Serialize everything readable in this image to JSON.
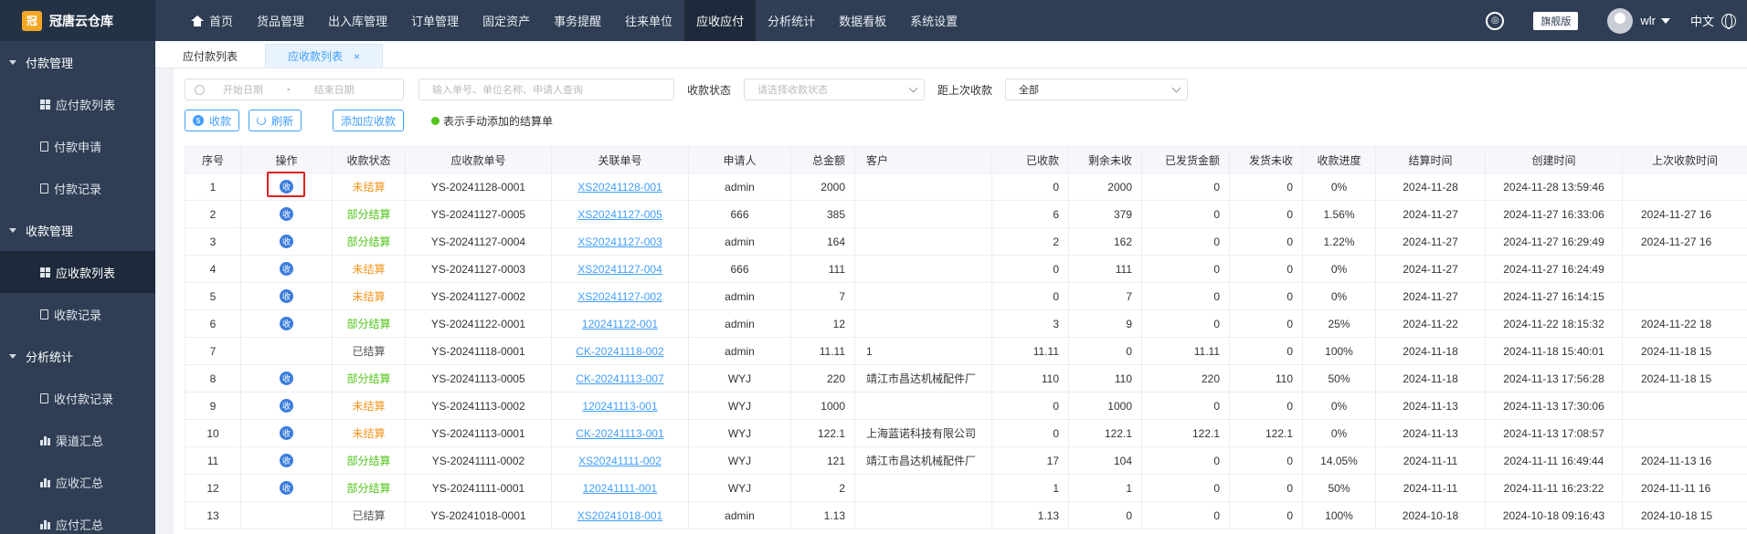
{
  "brand": {
    "logo_text": "冠",
    "name": "冠唐云仓库"
  },
  "nav": [
    {
      "label": "首页",
      "active": false
    },
    {
      "label": "货品管理",
      "active": false
    },
    {
      "label": "出入库管理",
      "active": false
    },
    {
      "label": "订单管理",
      "active": false
    },
    {
      "label": "固定资产",
      "active": false
    },
    {
      "label": "事务提醒",
      "active": false
    },
    {
      "label": "往来单位",
      "active": false
    },
    {
      "label": "应收应付",
      "active": true
    },
    {
      "label": "分析统计",
      "active": false
    },
    {
      "label": "数据看板",
      "active": false
    },
    {
      "label": "系统设置",
      "active": false
    }
  ],
  "topright": {
    "github_glyph": "◎",
    "edition": "旗舰版",
    "user": "wlr",
    "language": "中文"
  },
  "sidebar": [
    {
      "type": "group",
      "label": "付款管理"
    },
    {
      "type": "item",
      "icon": "grid",
      "label": "应付款列表"
    },
    {
      "type": "item",
      "icon": "doc",
      "label": "付款申请"
    },
    {
      "type": "item",
      "icon": "doc",
      "label": "付款记录"
    },
    {
      "type": "group",
      "label": "收款管理"
    },
    {
      "type": "item",
      "icon": "grid",
      "label": "应收款列表",
      "active": true
    },
    {
      "type": "item",
      "icon": "doc",
      "label": "收款记录"
    },
    {
      "type": "group",
      "label": "分析统计"
    },
    {
      "type": "item",
      "icon": "doc",
      "label": "收付款记录"
    },
    {
      "type": "item",
      "icon": "bar",
      "label": "渠道汇总"
    },
    {
      "type": "item",
      "icon": "bar",
      "label": "应收汇总"
    },
    {
      "type": "item",
      "icon": "bar",
      "label": "应付汇总"
    }
  ],
  "tabs": [
    {
      "label": "应付款列表",
      "active": false
    },
    {
      "label": "应收款列表",
      "active": true,
      "closable": true
    }
  ],
  "filters": {
    "start_date_placeholder": "开始日期",
    "date_separator": "-",
    "end_date_placeholder": "结束日期",
    "search_placeholder": "输入单号、单位名称、申请人查询",
    "status_label": "收款状态",
    "status_placeholder": "请选择收款状态",
    "since_label": "距上次收款",
    "since_value": "全部"
  },
  "buttons": {
    "collect": "收款",
    "refresh": "刷新",
    "add": "添加应收款",
    "legend": "表示手动添加的结算单"
  },
  "table": {
    "columns": [
      "序号",
      "操作",
      "收款状态",
      "应收款单号",
      "关联单号",
      "申请人",
      "总金额",
      "客户",
      "已收款",
      "剩余未收",
      "已发货金额",
      "发货未收",
      "收款进度",
      "结算时间",
      "创建时间",
      "上次收款时间"
    ],
    "op_glyph": "收",
    "rows": [
      {
        "no": "1",
        "op": true,
        "status": "未结算",
        "code": "YS-20241128-0001",
        "ref": "XS20241128-001",
        "applicant": "admin",
        "total": "2000",
        "customer": "",
        "received": "0",
        "remaining": "2000",
        "shipped": "0",
        "ship_unpaid": "0",
        "progress": "0%",
        "settle": "2024-11-28",
        "created": "2024-11-28 13:59:46",
        "last": ""
      },
      {
        "no": "2",
        "op": true,
        "status": "部分结算",
        "code": "YS-20241127-0005",
        "ref": "XS20241127-005",
        "applicant": "666",
        "total": "385",
        "customer": "",
        "received": "6",
        "remaining": "379",
        "shipped": "0",
        "ship_unpaid": "0",
        "progress": "1.56%",
        "settle": "2024-11-27",
        "created": "2024-11-27 16:33:06",
        "last": "2024-11-27 16"
      },
      {
        "no": "3",
        "op": true,
        "status": "部分结算",
        "code": "YS-20241127-0004",
        "ref": "XS20241127-003",
        "applicant": "admin",
        "total": "164",
        "customer": "",
        "received": "2",
        "remaining": "162",
        "shipped": "0",
        "ship_unpaid": "0",
        "progress": "1.22%",
        "settle": "2024-11-27",
        "created": "2024-11-27 16:29:49",
        "last": "2024-11-27 16"
      },
      {
        "no": "4",
        "op": true,
        "status": "未结算",
        "code": "YS-20241127-0003",
        "ref": "XS20241127-004",
        "applicant": "666",
        "total": "111",
        "customer": "",
        "received": "0",
        "remaining": "111",
        "shipped": "0",
        "ship_unpaid": "0",
        "progress": "0%",
        "settle": "2024-11-27",
        "created": "2024-11-27 16:24:49",
        "last": ""
      },
      {
        "no": "5",
        "op": true,
        "status": "未结算",
        "code": "YS-20241127-0002",
        "ref": "XS20241127-002",
        "applicant": "admin",
        "total": "7",
        "customer": "",
        "received": "0",
        "remaining": "7",
        "shipped": "0",
        "ship_unpaid": "0",
        "progress": "0%",
        "settle": "2024-11-27",
        "created": "2024-11-27 16:14:15",
        "last": ""
      },
      {
        "no": "6",
        "op": true,
        "status": "部分结算",
        "code": "YS-20241122-0001",
        "ref": "120241122-001",
        "applicant": "admin",
        "total": "12",
        "customer": "",
        "received": "3",
        "remaining": "9",
        "shipped": "0",
        "ship_unpaid": "0",
        "progress": "25%",
        "settle": "2024-11-22",
        "created": "2024-11-22 18:15:32",
        "last": "2024-11-22 18"
      },
      {
        "no": "7",
        "op": false,
        "status": "已结算",
        "code": "YS-20241118-0001",
        "ref": "CK-20241118-002",
        "applicant": "admin",
        "total": "11.11",
        "customer": "1",
        "received": "11.11",
        "remaining": "0",
        "shipped": "11.11",
        "ship_unpaid": "0",
        "progress": "100%",
        "settle": "2024-11-18",
        "created": "2024-11-18 15:40:01",
        "last": "2024-11-18 15"
      },
      {
        "no": "8",
        "op": true,
        "status": "部分结算",
        "code": "YS-20241113-0005",
        "ref": "CK-20241113-007",
        "applicant": "WYJ",
        "total": "220",
        "customer": "靖江市昌达机械配件厂",
        "received": "110",
        "remaining": "110",
        "shipped": "220",
        "ship_unpaid": "110",
        "progress": "50%",
        "settle": "2024-11-18",
        "created": "2024-11-13 17:56:28",
        "last": "2024-11-18 15"
      },
      {
        "no": "9",
        "op": true,
        "status": "未结算",
        "code": "YS-20241113-0002",
        "ref": "120241113-001",
        "applicant": "WYJ",
        "total": "1000",
        "customer": "",
        "received": "0",
        "remaining": "1000",
        "shipped": "0",
        "ship_unpaid": "0",
        "progress": "0%",
        "settle": "2024-11-13",
        "created": "2024-11-13 17:30:06",
        "last": ""
      },
      {
        "no": "10",
        "op": true,
        "status": "未结算",
        "code": "YS-20241113-0001",
        "ref": "CK-20241113-001",
        "applicant": "WYJ",
        "total": "122.1",
        "customer": "上海蓝诺科技有限公司",
        "received": "0",
        "remaining": "122.1",
        "shipped": "122.1",
        "ship_unpaid": "122.1",
        "progress": "0%",
        "settle": "2024-11-13",
        "created": "2024-11-13 17:08:57",
        "last": ""
      },
      {
        "no": "11",
        "op": true,
        "status": "部分结算",
        "code": "YS-20241111-0002",
        "ref": "XS20241111-002",
        "applicant": "WYJ",
        "total": "121",
        "customer": "靖江市昌达机械配件厂",
        "received": "17",
        "remaining": "104",
        "shipped": "0",
        "ship_unpaid": "0",
        "progress": "14.05%",
        "settle": "2024-11-11",
        "created": "2024-11-11 16:49:44",
        "last": "2024-11-13 16"
      },
      {
        "no": "12",
        "op": true,
        "status": "部分结算",
        "code": "YS-20241111-0001",
        "ref": "120241111-001",
        "applicant": "WYJ",
        "total": "2",
        "customer": "",
        "received": "1",
        "remaining": "1",
        "shipped": "0",
        "ship_unpaid": "0",
        "progress": "50%",
        "settle": "2024-11-11",
        "created": "2024-11-11 16:23:22",
        "last": "2024-11-11 16"
      },
      {
        "no": "13",
        "op": false,
        "status": "已结算",
        "code": "YS-20241018-0001",
        "ref": "XS20241018-001",
        "applicant": "admin",
        "total": "1.13",
        "customer": "",
        "received": "1.13",
        "remaining": "0",
        "shipped": "0",
        "ship_unpaid": "0",
        "progress": "100%",
        "settle": "2024-10-18",
        "created": "2024-10-18 09:16:43",
        "last": "2024-10-18 15"
      }
    ]
  }
}
